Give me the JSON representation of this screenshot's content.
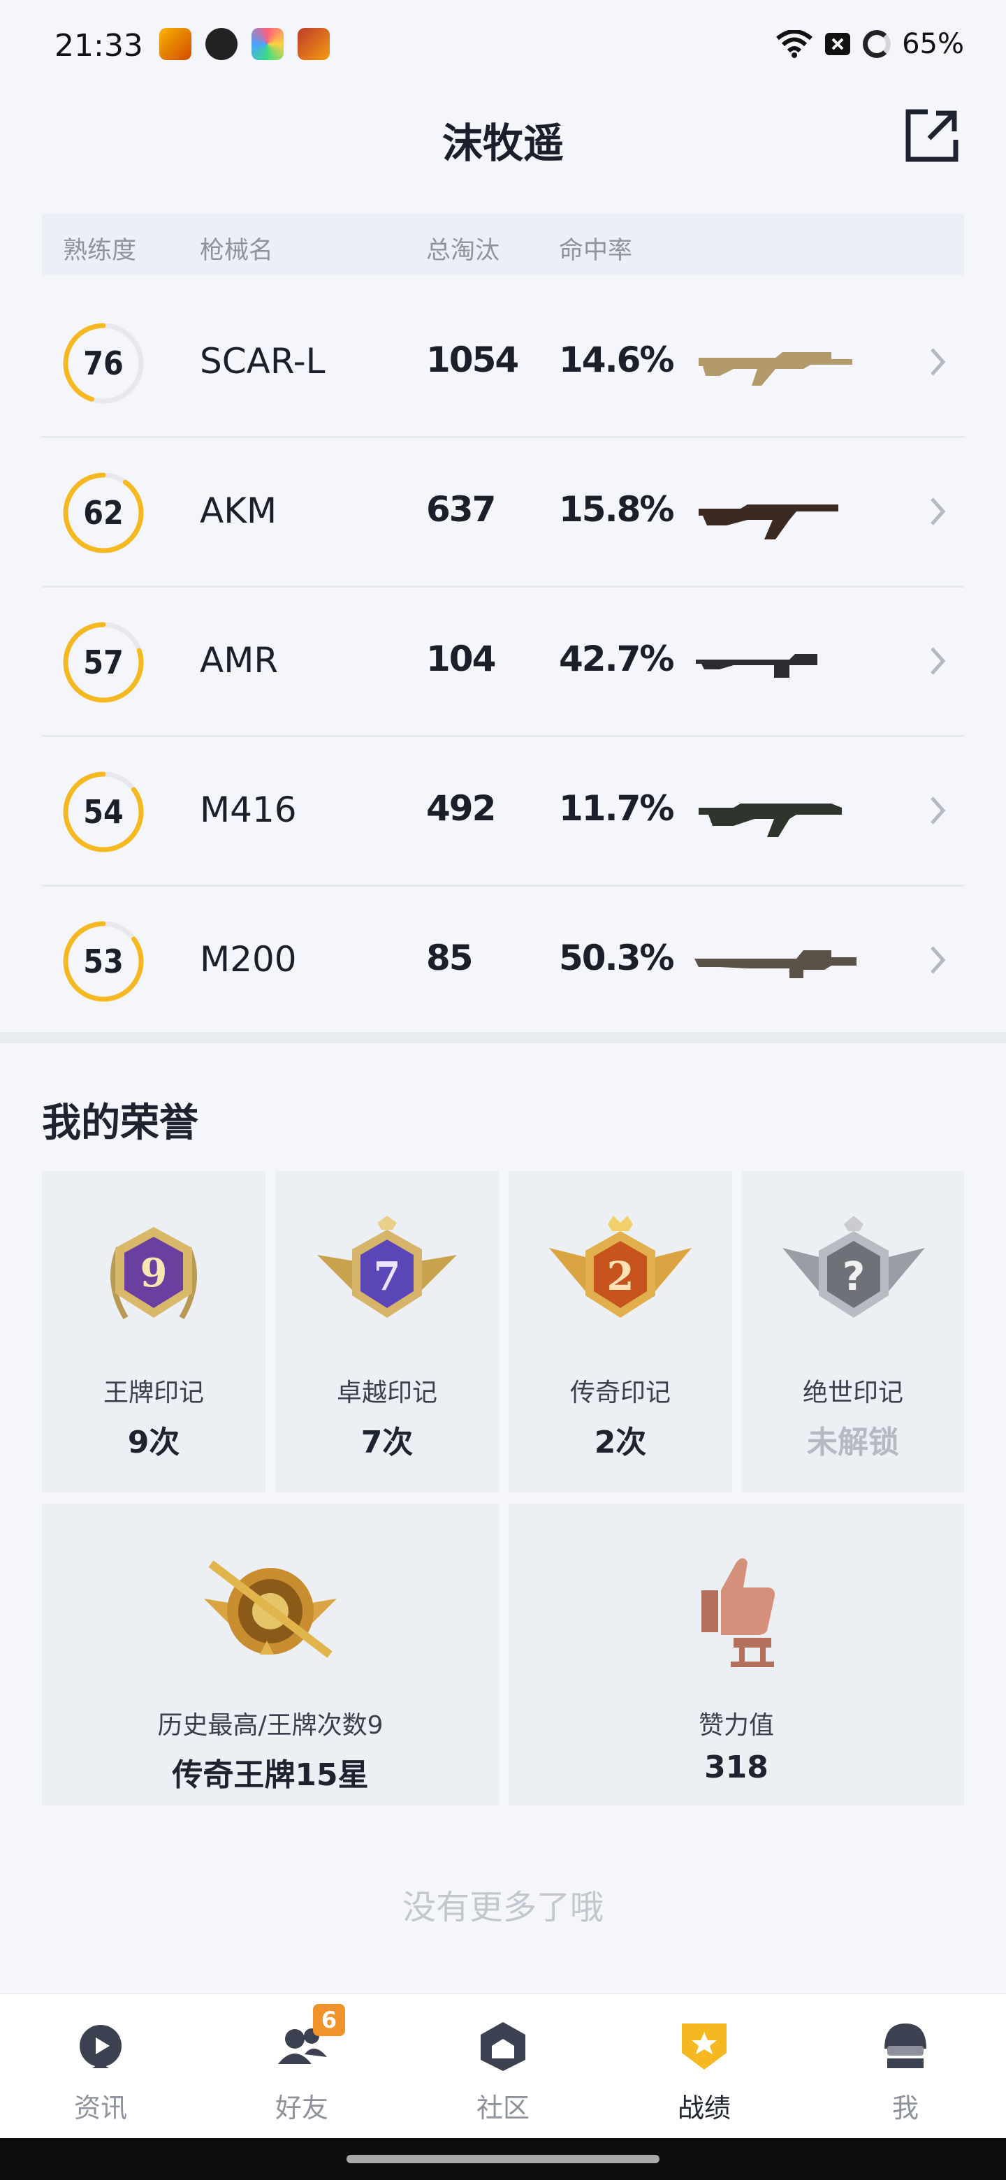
{
  "status_bar": {
    "time": "21:33",
    "battery": "65%",
    "app_icons": [
      "game-app-icon",
      "wechat-icon",
      "photos-app-icon",
      "hero-game-icon"
    ]
  },
  "header": {
    "title": "沫牧遥"
  },
  "table": {
    "headers": {
      "mastery": "熟练度",
      "weapon": "枪械名",
      "kills": "总淘汰",
      "accuracy": "命中率"
    },
    "rows": [
      {
        "mastery": "76",
        "mastery_fraction": 0.45,
        "weapon": "SCAR-L",
        "kills": "1054",
        "accuracy": "14.6%",
        "gun_icon": "scar-l-rifle",
        "gun_color": "#b39a6a"
      },
      {
        "mastery": "62",
        "mastery_fraction": 0.9,
        "weapon": "AKM",
        "kills": "637",
        "accuracy": "15.8%",
        "gun_icon": "akm-rifle",
        "gun_color": "#3a2a22"
      },
      {
        "mastery": "57",
        "mastery_fraction": 0.8,
        "weapon": "AMR",
        "kills": "104",
        "accuracy": "42.7%",
        "gun_icon": "amr-sniper",
        "gun_color": "#2b2d31"
      },
      {
        "mastery": "54",
        "mastery_fraction": 0.85,
        "weapon": "M416",
        "kills": "492",
        "accuracy": "11.7%",
        "gun_icon": "m416-rifle",
        "gun_color": "#2f342c"
      },
      {
        "mastery": "53",
        "mastery_fraction": 0.85,
        "weapon": "M200",
        "kills": "85",
        "accuracy": "50.3%",
        "gun_icon": "m200-sniper",
        "gun_color": "#5a5246"
      }
    ]
  },
  "honors": {
    "title": "我的荣誉",
    "marks": [
      {
        "label": "王牌印记",
        "value": "9次",
        "badge": "ace-mark-badge",
        "numeral": "9",
        "color": "#6a3fa0",
        "locked": false
      },
      {
        "label": "卓越印记",
        "value": "7次",
        "badge": "excellence-mark-badge",
        "numeral": "7",
        "color": "#5b46b8",
        "locked": false
      },
      {
        "label": "传奇印记",
        "value": "2次",
        "badge": "legend-mark-badge",
        "numeral": "2",
        "color": "#c8541d",
        "locked": false
      },
      {
        "label": "绝世印记",
        "value": "未解锁",
        "badge": "peerless-mark-badge",
        "numeral": "?",
        "color": "#7a7d84",
        "locked": true
      }
    ],
    "summary": [
      {
        "label": "历史最高/王牌次数9",
        "value": "传奇王牌15星",
        "badge": "rank-crest-badge"
      },
      {
        "label": "赞力值",
        "value": "318",
        "badge": "thumbs-up-trophy-icon"
      }
    ]
  },
  "footer_note": "没有更多了哦",
  "bottom_nav": {
    "items": [
      {
        "label": "资讯",
        "icon": "news-icon",
        "active": false,
        "badge": ""
      },
      {
        "label": "好友",
        "icon": "friends-icon",
        "active": false,
        "badge": "6"
      },
      {
        "label": "社区",
        "icon": "community-icon",
        "active": false,
        "badge": ""
      },
      {
        "label": "战绩",
        "icon": "record-icon",
        "active": true,
        "badge": ""
      },
      {
        "label": "我",
        "icon": "profile-icon",
        "active": false,
        "badge": ""
      }
    ]
  },
  "colors": {
    "accent": "#f5b820",
    "ring_track": "#e6e8ed",
    "badge_orange": "#f0932b"
  }
}
